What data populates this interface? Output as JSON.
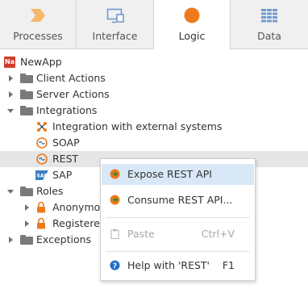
{
  "tabs": [
    {
      "label": "Processes",
      "icon": "processes-chevron-icon",
      "active": false
    },
    {
      "label": "Interface",
      "icon": "interface-screen-icon",
      "active": false
    },
    {
      "label": "Logic",
      "icon": "logic-circle-icon",
      "active": true
    },
    {
      "label": "Data",
      "icon": "data-grid-icon",
      "active": false
    }
  ],
  "tree": {
    "app": {
      "badge": "Na",
      "label": "NewApp"
    },
    "client_actions": {
      "label": "Client Actions"
    },
    "server_actions": {
      "label": "Server Actions"
    },
    "integrations": {
      "label": "Integrations"
    },
    "integration_external": {
      "label": "Integration with external systems"
    },
    "soap": {
      "label": "SOAP"
    },
    "rest": {
      "label": "REST"
    },
    "sap": {
      "label": "SAP"
    },
    "roles": {
      "label": "Roles"
    },
    "anonymous": {
      "label": "Anonymous"
    },
    "registered": {
      "label": "Registered"
    },
    "exceptions": {
      "label": "Exceptions"
    }
  },
  "context_menu": {
    "expose": {
      "label": "Expose REST API",
      "icon": "rest-arrow-icon"
    },
    "consume": {
      "label": "Consume REST API...",
      "icon": "rest-arrow-icon"
    },
    "paste": {
      "label": "Paste",
      "shortcut": "Ctrl+V",
      "disabled": true
    },
    "help": {
      "label": "Help with 'REST'",
      "shortcut": "F1",
      "icon": "help-icon"
    }
  },
  "colors": {
    "accent_orange": "#ee7a1b",
    "tab_blue": "#6f9bd1",
    "selection_row": "#e6e6e6",
    "menu_hover": "#d9e8f6",
    "app_badge": "#d33c2c"
  }
}
